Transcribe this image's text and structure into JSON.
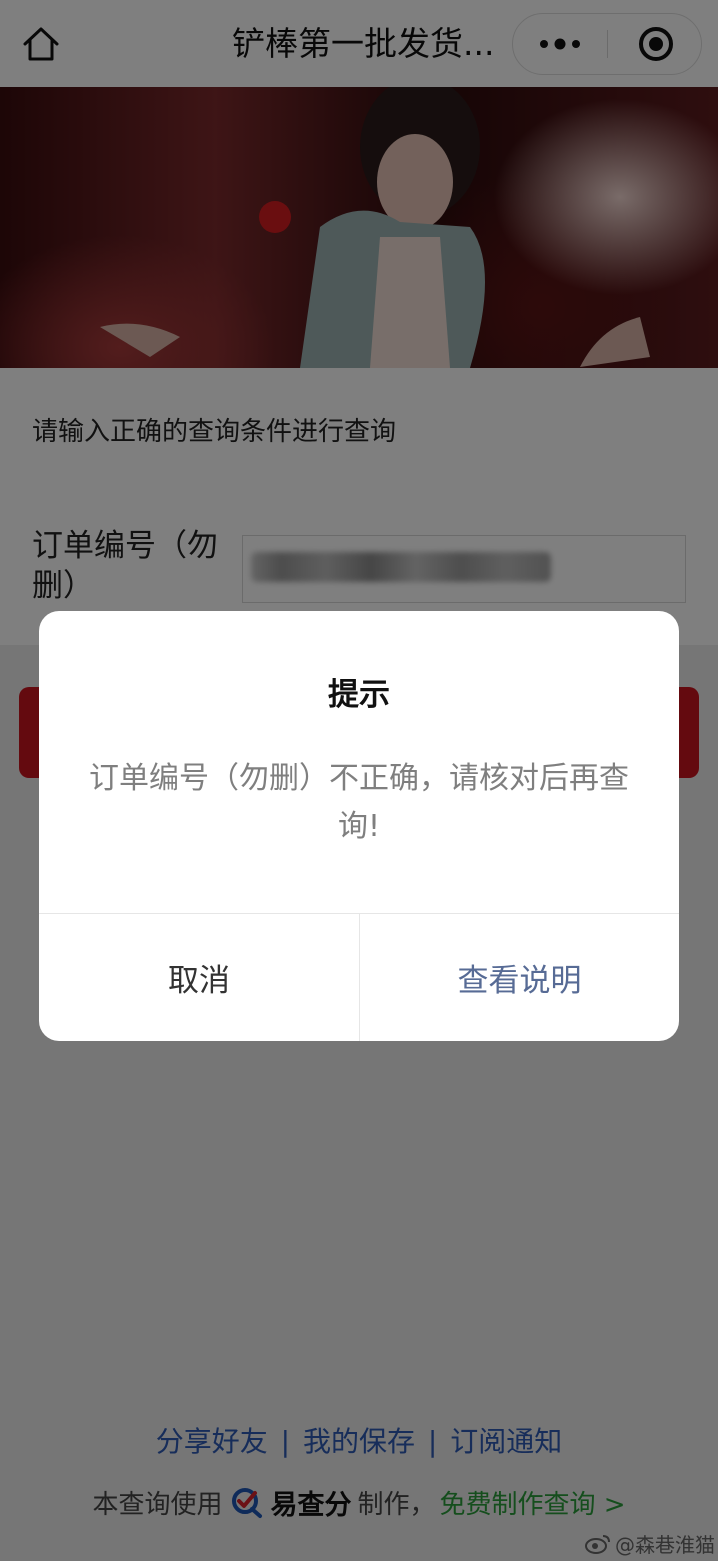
{
  "navbar": {
    "title": "铲棒第一批发货...",
    "icons": {
      "home": "home-icon",
      "more": "more-dots-icon",
      "close": "target-close-icon"
    }
  },
  "banner": {
    "image": "concert-performer-photo"
  },
  "form": {
    "hint": "请输入正确的查询条件进行查询",
    "order_label": "订单编号（勿删）",
    "order_value": ""
  },
  "dialog": {
    "title": "提示",
    "message": "订单编号（勿删）不正确，请核对后再查询!",
    "cancel_label": "取消",
    "confirm_label": "查看说明"
  },
  "footer": {
    "links": [
      "分享好友",
      "我的保存",
      "订阅通知"
    ],
    "separator": "|",
    "credit_prefix": "本查询使用",
    "brand": "易查分",
    "credit_suffix": "制作，",
    "free_link": "免费制作查询 >"
  },
  "watermark": {
    "text": "@森巷淮猫"
  },
  "colors": {
    "brand_red": "#c8141e",
    "link_blue": "#2f5bb5",
    "dialog_confirm": "#576b95",
    "free_green": "#2a9d3a"
  }
}
